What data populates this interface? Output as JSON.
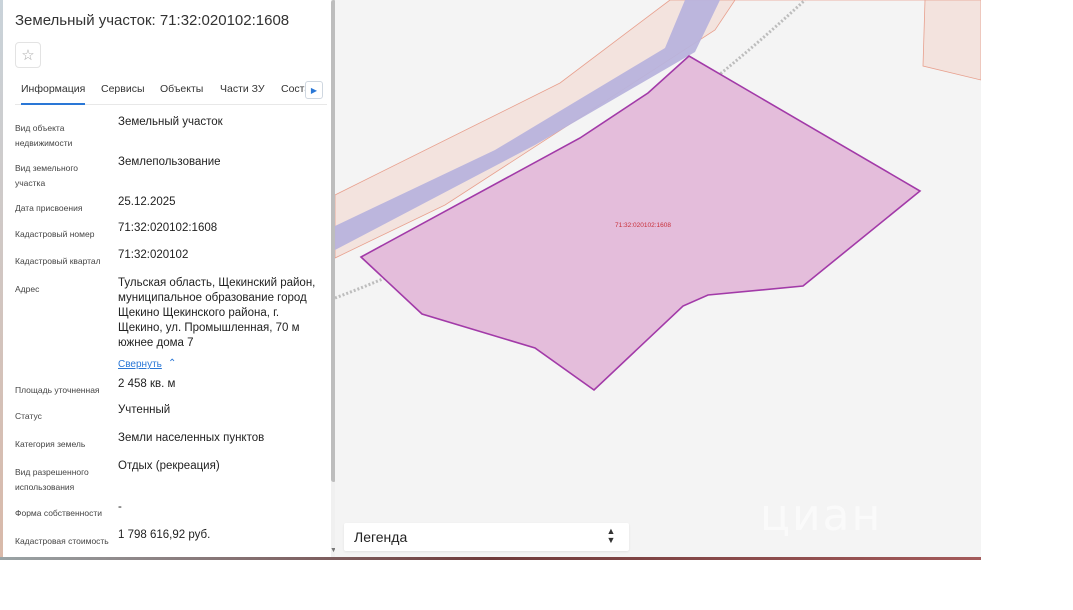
{
  "panel": {
    "title": "Земельный участок: 71:32:020102:1608",
    "favorite_icon": "star-outline-icon",
    "tabs": [
      {
        "label": "Информация",
        "active": true
      },
      {
        "label": "Сервисы",
        "active": false
      },
      {
        "label": "Объекты",
        "active": false
      },
      {
        "label": "Части ЗУ",
        "active": false
      },
      {
        "label": "Соста",
        "active": false
      }
    ],
    "tab_scroll_icon": "chevron-right-icon",
    "properties": [
      {
        "label": "Вид объекта недвижимости",
        "value": "Земельный участок"
      },
      {
        "label": "Вид земельного участка",
        "value": "Землепользование"
      },
      {
        "label": "Дата присвоения",
        "value": "25.12.2025"
      },
      {
        "label": "Кадастровый номер",
        "value": "71:32:020102:1608"
      },
      {
        "label": "Кадастровый квартал",
        "value": "71:32:020102"
      },
      {
        "label": "Адрес",
        "value": "Тульская область, Щекинский район, муниципальное образование город Щекино Щекинского района, г. Щекино, ул. Промышленная, 70 м южнее дома 7"
      },
      {
        "label": "Площадь уточненная",
        "value": "2 458 кв. м"
      },
      {
        "label": "Статус",
        "value": "Учтенный"
      },
      {
        "label": "Категория земель",
        "value": "Земли населенных пунктов"
      },
      {
        "label": "Вид разрешенного использования",
        "value": "Отдых (рекреация)"
      },
      {
        "label": "Форма собственности",
        "value": "-"
      },
      {
        "label": "Кадастровая стоимость",
        "value": "1 798 616,92 руб."
      }
    ],
    "collapse_link": "Свернуть",
    "collapse_icon": "chevron-up-icon"
  },
  "map": {
    "parcel_label": "71:32:020102:1608",
    "parcel_fill": "#e4bddb",
    "parcel_stroke": "#a23aa8",
    "road_fill": "#b8b3dc",
    "zone_fill": "#f3e3de",
    "zone_stroke": "#e8a08e"
  },
  "legend": {
    "label": "Легенда",
    "icon": "chevron-up-down-icon"
  },
  "watermark": "циан"
}
